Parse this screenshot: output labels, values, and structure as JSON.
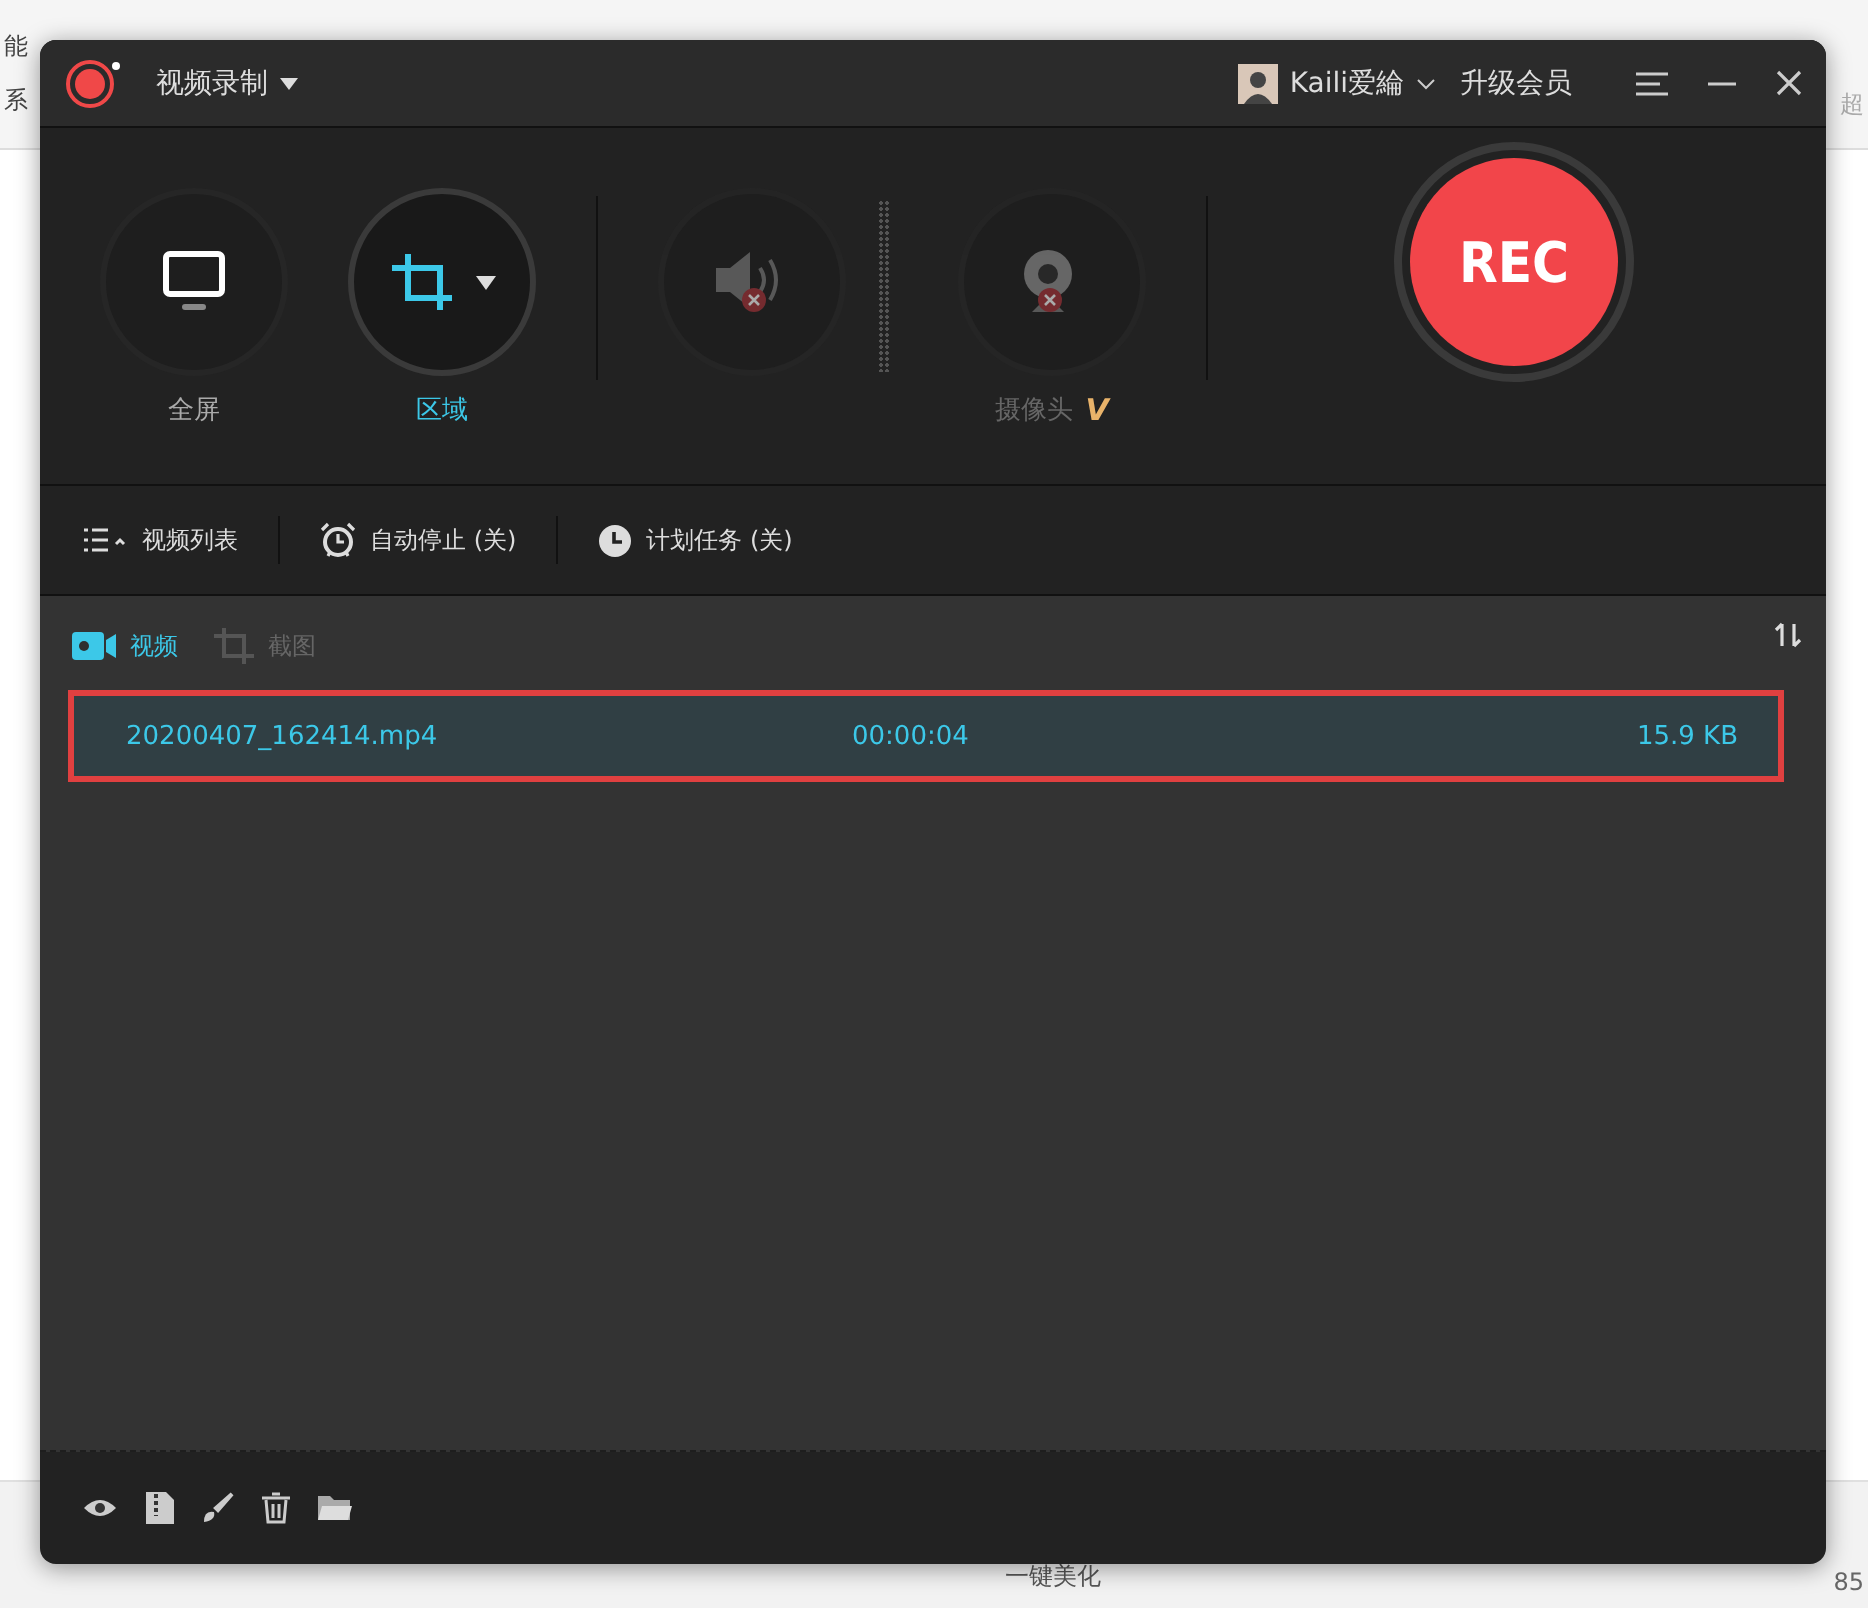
{
  "background_app": {
    "top_left": [
      "能",
      "系"
    ],
    "top_right": "超",
    "bottom_button": "一键美化",
    "zoom": "85"
  },
  "window": {
    "title": "视频录制",
    "user": "Kaili爱綸",
    "upgrade": "升级会员"
  },
  "modes": [
    {
      "kind": "screen",
      "label": "全屏",
      "selected": false,
      "disabled": false
    },
    {
      "kind": "region",
      "label": "区域",
      "selected": true,
      "disabled": false
    },
    {
      "kind": "audio",
      "selected": false,
      "disabled": true
    },
    {
      "kind": "camera",
      "label": "摄像头",
      "badge": "V",
      "selected": false,
      "disabled": true
    }
  ],
  "rec_button": "REC",
  "toolbar": [
    {
      "kind": "list",
      "label": "视频列表"
    },
    {
      "kind": "alarm",
      "label": "自动停止 (关)"
    },
    {
      "kind": "clock",
      "label": "计划任务 (关)"
    }
  ],
  "tabs": [
    {
      "kind": "video",
      "label": "视频",
      "selected": true
    },
    {
      "kind": "screenshot",
      "label": "截图",
      "selected": false
    }
  ],
  "files": [
    {
      "name": "20200407_162414.mp4",
      "duration": "00:00:04",
      "size": "15.9 KB",
      "selected": true,
      "highlighted": true
    }
  ]
}
